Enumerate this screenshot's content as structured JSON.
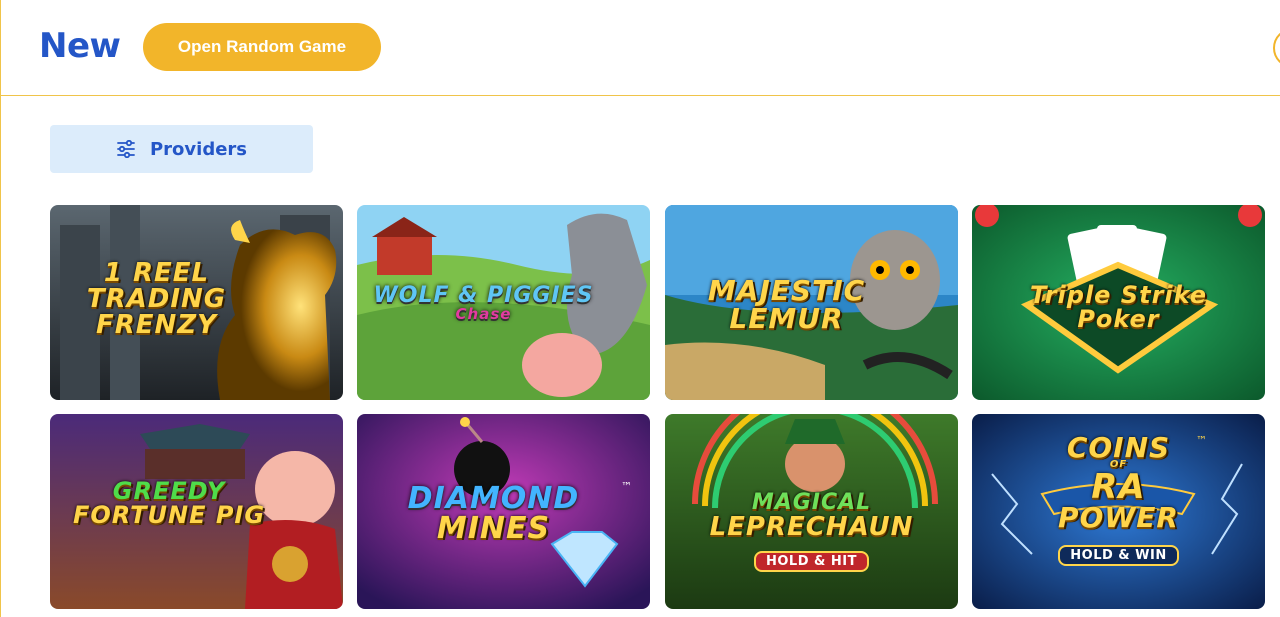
{
  "header": {
    "title": "New",
    "random_button_label": "Open Random Game"
  },
  "filters": {
    "providers_label": "Providers",
    "icon": "sliders-icon"
  },
  "games": [
    {
      "line1": "1 REEL",
      "line2": "TRADING",
      "line3": "FRENZY",
      "theme": "bull"
    },
    {
      "line1": "WOLF & PIGGIES",
      "line2": "Chase",
      "theme": "farm"
    },
    {
      "line1": "MAJESTIC",
      "line2": "LEMUR",
      "theme": "jungle"
    },
    {
      "line1": "Triple Strike",
      "line2": "Poker",
      "theme": "poker"
    },
    {
      "line1": "GREEDY",
      "line2": "FORTUNE PIG",
      "theme": "pig"
    },
    {
      "line1": "DIAMOND",
      "line2": "MINES",
      "trademark": "™",
      "theme": "diamond"
    },
    {
      "line1": "MAGICAL",
      "line2": "LEPRECHAUN",
      "badge": "HOLD & HIT",
      "theme": "leprechaun"
    },
    {
      "line1": "COINS",
      "line_of": "OF",
      "line2": "RA",
      "line3": "POWER",
      "trademark": "™",
      "badge": "HOLD & WIN",
      "theme": "ra"
    }
  ],
  "colors": {
    "accent_blue": "#2456c7",
    "accent_gold": "#f2b52a",
    "providers_bg": "#dcecfb"
  }
}
